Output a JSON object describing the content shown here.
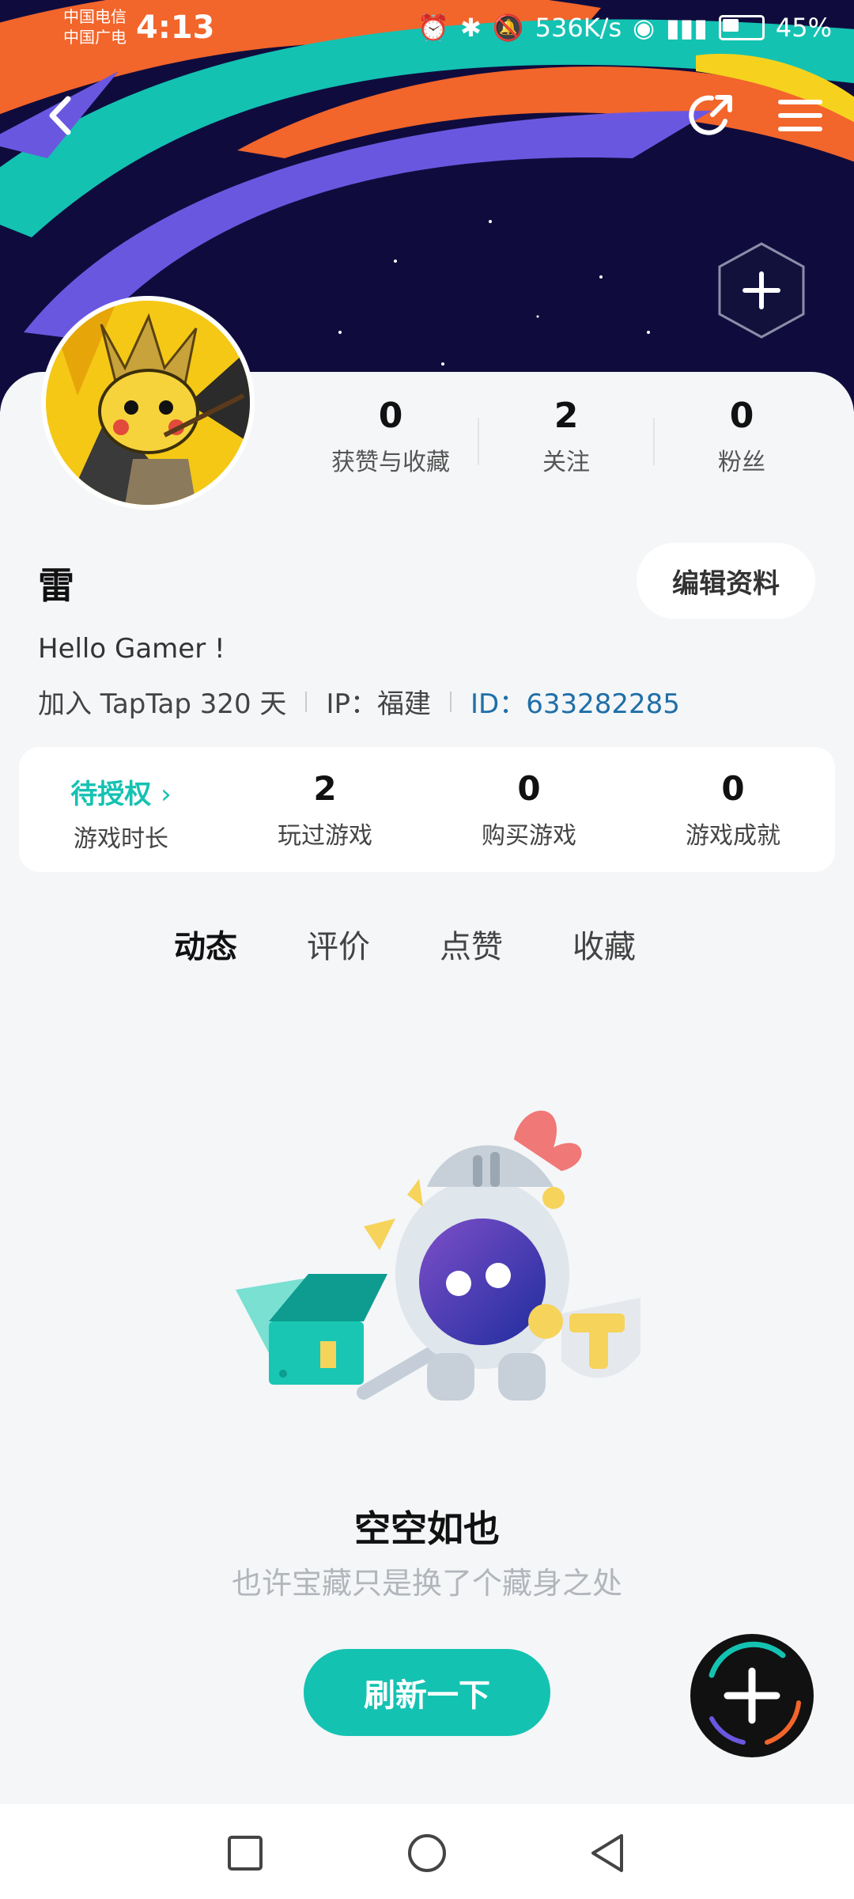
{
  "status_bar": {
    "carrier1": "中国电信",
    "carrier2": "中国广电",
    "time": "4:13",
    "net_speed": "536K/s",
    "battery": "45%"
  },
  "profile": {
    "name": "雷",
    "bio": "Hello Gamer !",
    "joined": "加入 TapTap 320 天",
    "ip": "IP：福建",
    "id_label": "ID：",
    "id_value": "633282285",
    "edit_label": "编辑资料"
  },
  "stats": [
    {
      "value": "0",
      "label": "获赞与收藏"
    },
    {
      "value": "2",
      "label": "关注"
    },
    {
      "value": "0",
      "label": "粉丝"
    }
  ],
  "game_stats": [
    {
      "value": "待授权",
      "label": "游戏时长"
    },
    {
      "value": "2",
      "label": "玩过游戏"
    },
    {
      "value": "0",
      "label": "购买游戏"
    },
    {
      "value": "0",
      "label": "游戏成就"
    }
  ],
  "tabs": [
    {
      "label": "动态",
      "active": true
    },
    {
      "label": "评价"
    },
    {
      "label": "点赞"
    },
    {
      "label": "收藏"
    }
  ],
  "empty_state": {
    "title": "空空如也",
    "subtitle": "也许宝藏只是换了个藏身之处",
    "button": "刷新一下"
  },
  "colors": {
    "accent": "#14c2b2",
    "banner_bg": "#0f0c3d",
    "id_link": "#1f6fa8"
  }
}
